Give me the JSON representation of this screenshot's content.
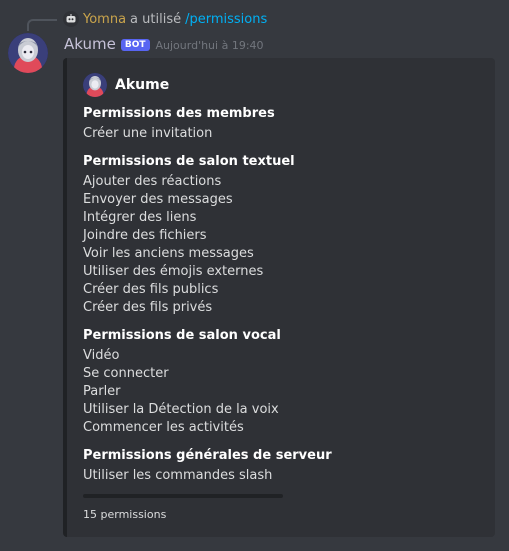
{
  "reply": {
    "user": "Yomna",
    "action": "a utilisé",
    "command": "/permissions"
  },
  "message": {
    "username": "Akume",
    "bot_tag": "BOT",
    "timestamp": "Aujourd'hui à 19:40"
  },
  "embed": {
    "author": "Akume",
    "fields": [
      {
        "name": "Permissions des membres",
        "values": [
          "Créer une invitation"
        ]
      },
      {
        "name": "Permissions de salon textuel",
        "values": [
          "Ajouter des réactions",
          "Envoyer des messages",
          "Intégrer des liens",
          "Joindre des fichiers",
          "Voir les anciens messages",
          "Utiliser des émojis externes",
          "Créer des fils publics",
          "Créer des fils privés"
        ]
      },
      {
        "name": "Permissions de salon vocal",
        "values": [
          "Vidéo",
          "Se connecter",
          "Parler",
          "Utiliser la Détection de la voix",
          "Commencer les activités"
        ]
      },
      {
        "name": "Permissions générales de serveur",
        "values": [
          "Utiliser les commandes slash"
        ]
      }
    ],
    "footer": "15 permissions"
  },
  "colors": {
    "background": "#36393f",
    "embed_background": "#2f3136",
    "embed_border": "#202225",
    "reply_user": "#c9a44c",
    "command": "#00b0f4",
    "bot_tag": "#5865f2"
  },
  "icons": {
    "reply_avatar": "discord-bot-icon",
    "avatar": "akume-avatar",
    "author_icon": "akume-avatar"
  }
}
